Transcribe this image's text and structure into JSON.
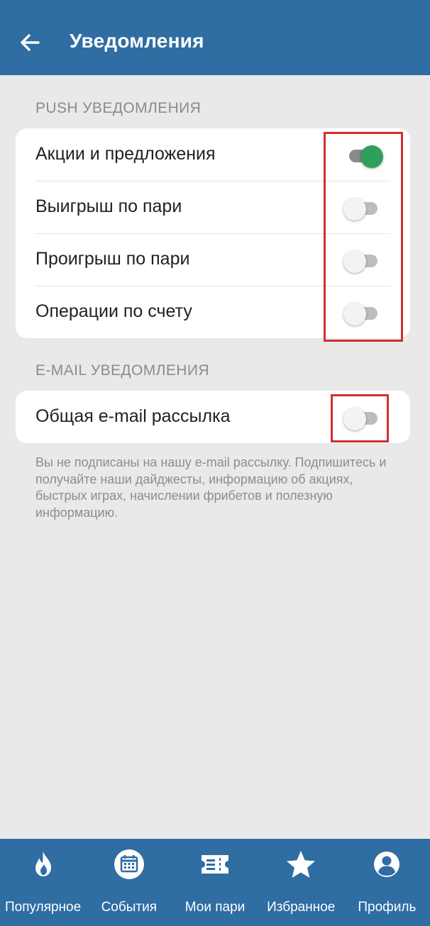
{
  "header": {
    "title": "Уведомления",
    "back_icon": "arrow-left-icon"
  },
  "push_section": {
    "title": "PUSH УВЕДОМЛЕНИЯ",
    "items": [
      {
        "label": "Акции и предложения",
        "enabled": true
      },
      {
        "label": "Выигрыш по пари",
        "enabled": false
      },
      {
        "label": "Проигрыш по пари",
        "enabled": false
      },
      {
        "label": "Операции по счету",
        "enabled": false
      }
    ]
  },
  "email_section": {
    "title": "E-MAIL УВЕДОМЛЕНИЯ",
    "items": [
      {
        "label": "Общая e-mail рассылка",
        "enabled": false
      }
    ],
    "note": "Вы не подписаны на нашу e-mail рассылку. Подпишитесь и получайте наши дайджесты, информацию об акциях, быстрых играх, начислении фрибетов и полезную информацию."
  },
  "bottom_nav": {
    "items": [
      {
        "label": "Популярное",
        "icon": "flame-icon"
      },
      {
        "label": "События",
        "icon": "calendar-icon"
      },
      {
        "label": "Мои пари",
        "icon": "ticket-icon"
      },
      {
        "label": "Избранное",
        "icon": "star-icon"
      },
      {
        "label": "Профиль",
        "icon": "profile-icon"
      }
    ]
  },
  "colors": {
    "primary": "#2f6da3",
    "toggle_on": "#2ea05a",
    "highlight": "#d32f2f",
    "background": "#e9e9ea"
  }
}
